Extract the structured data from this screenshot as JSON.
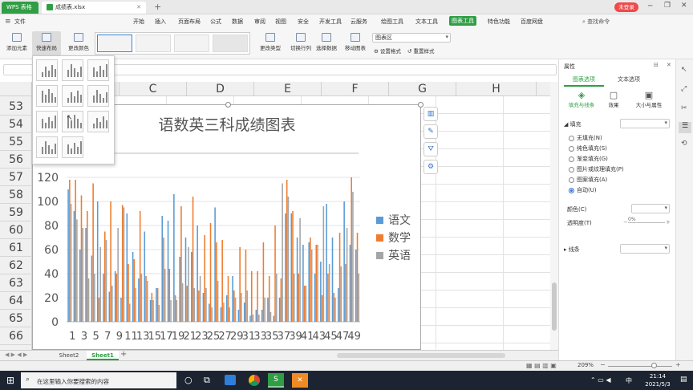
{
  "titlebar": {
    "app_tab": "WPS 表格",
    "file_tab": "成绩表.xlsx",
    "login": "未登录"
  },
  "menubar": {
    "file": "文件",
    "items": [
      "开始",
      "插入",
      "页面布局",
      "公式",
      "数据",
      "审阅",
      "视图",
      "安全",
      "开发工具",
      "云服务",
      "绘图工具",
      "文本工具",
      "图表工具",
      "特色功能",
      "百度网盘"
    ],
    "active": "图表工具",
    "search": "查找命令"
  },
  "ribbon": {
    "add_element": "添加元素",
    "quick_layout": "快速布局",
    "change_color": "更改颜色",
    "change_type": "更改类型",
    "switch_row_col": "切换行列",
    "select_data": "选择数据",
    "move_chart": "移动图表",
    "chart_area_select": "图表区",
    "set_format": "设置格式",
    "reset_style": "重置样式"
  },
  "columns": [
    "B",
    "C",
    "D",
    "E",
    "F",
    "G",
    "H"
  ],
  "rows": [
    "53",
    "54",
    "55",
    "56",
    "57",
    "58",
    "59",
    "60",
    "61",
    "62",
    "63",
    "64",
    "65",
    "66"
  ],
  "chart_data": {
    "type": "bar",
    "title": "语数英三科成绩图表",
    "ylim": [
      0,
      120
    ],
    "yticks": [
      "0",
      "20",
      "40",
      "60",
      "80",
      "100",
      "120"
    ],
    "xticks": [
      "1",
      "3",
      "5",
      "7",
      "9",
      "11",
      "13",
      "15",
      "17",
      "19",
      "21",
      "23",
      "25",
      "27",
      "29",
      "31",
      "33",
      "35",
      "37",
      "39",
      "41",
      "43",
      "45",
      "47",
      "49"
    ],
    "legend_position": "right",
    "series": [
      {
        "name": "语文",
        "color": "#5b9bd5",
        "values": [
          110,
          92,
          60,
          78,
          55,
          100,
          40,
          25,
          42,
          20,
          90,
          58,
          36,
          75,
          18,
          28,
          88,
          84,
          106,
          54,
          70,
          58,
          80,
          24,
          15,
          95,
          12,
          22,
          38,
          10,
          16,
          5,
          10,
          10,
          20,
          5,
          20,
          90,
          90,
          70,
          64,
          66,
          40,
          50,
          98,
          70,
          28,
          100,
          64,
          60
        ]
      },
      {
        "name": "数学",
        "color": "#ed7d31",
        "values": [
          118,
          118,
          105,
          92,
          115,
          20,
          75,
          100,
          40,
          97,
          48,
          52,
          92,
          38,
          24,
          28,
          70,
          44,
          22,
          96,
          30,
          104,
          26,
          72,
          82,
          66,
          68,
          38,
          26,
          62,
          60,
          42,
          42,
          66,
          38,
          80,
          36,
          118,
          92,
          40,
          30,
          70,
          64,
          22,
          40,
          24,
          74,
          48,
          120,
          74
        ]
      },
      {
        "name": "英语",
        "color": "#a5a5a5",
        "values": [
          98,
          85,
          78,
          36,
          40,
          62,
          68,
          30,
          78,
          95,
          15,
          28,
          40,
          34,
          18,
          14,
          44,
          18,
          18,
          32,
          62,
          28,
          38,
          28,
          12,
          34,
          16,
          12,
          20,
          24,
          26,
          6,
          6,
          20,
          8,
          40,
          115,
          104,
          40,
          86,
          30,
          60,
          64,
          96,
          48,
          20,
          46,
          78,
          108,
          40
        ]
      }
    ]
  },
  "chart_tools": [
    "chart-elements",
    "chart-style",
    "chart-filter",
    "chart-settings"
  ],
  "sheets": {
    "tabs": [
      "Sheet2",
      "Sheet1"
    ],
    "active": "Sheet1",
    "add": "+"
  },
  "right_panel": {
    "title": "属性",
    "tabs": [
      "图表选项",
      "文本选项"
    ],
    "subtabs": [
      "填充与线条",
      "效果",
      "大小与属性"
    ],
    "fill_section": "填充",
    "fill_options": [
      "无填充(N)",
      "纯色填充(S)",
      "渐变填充(G)",
      "图片或纹理填充(P)",
      "图案填充(A)",
      "自动(U)"
    ],
    "fill_selected": "自动(U)",
    "color_label": "颜色(C)",
    "transparency_label": "透明度(T)",
    "transparency_value": "0%",
    "line_section": "线条"
  },
  "status": {
    "zoom": "209%"
  },
  "taskbar": {
    "search_placeholder": "在这里输入你要搜索的内容",
    "time": "21:14",
    "date": "2021/5/3",
    "ime": "中"
  },
  "colors": {
    "accent": "#2f9e44",
    "series1": "#5b9bd5",
    "series2": "#ed7d31",
    "series3": "#a5a5a5"
  }
}
